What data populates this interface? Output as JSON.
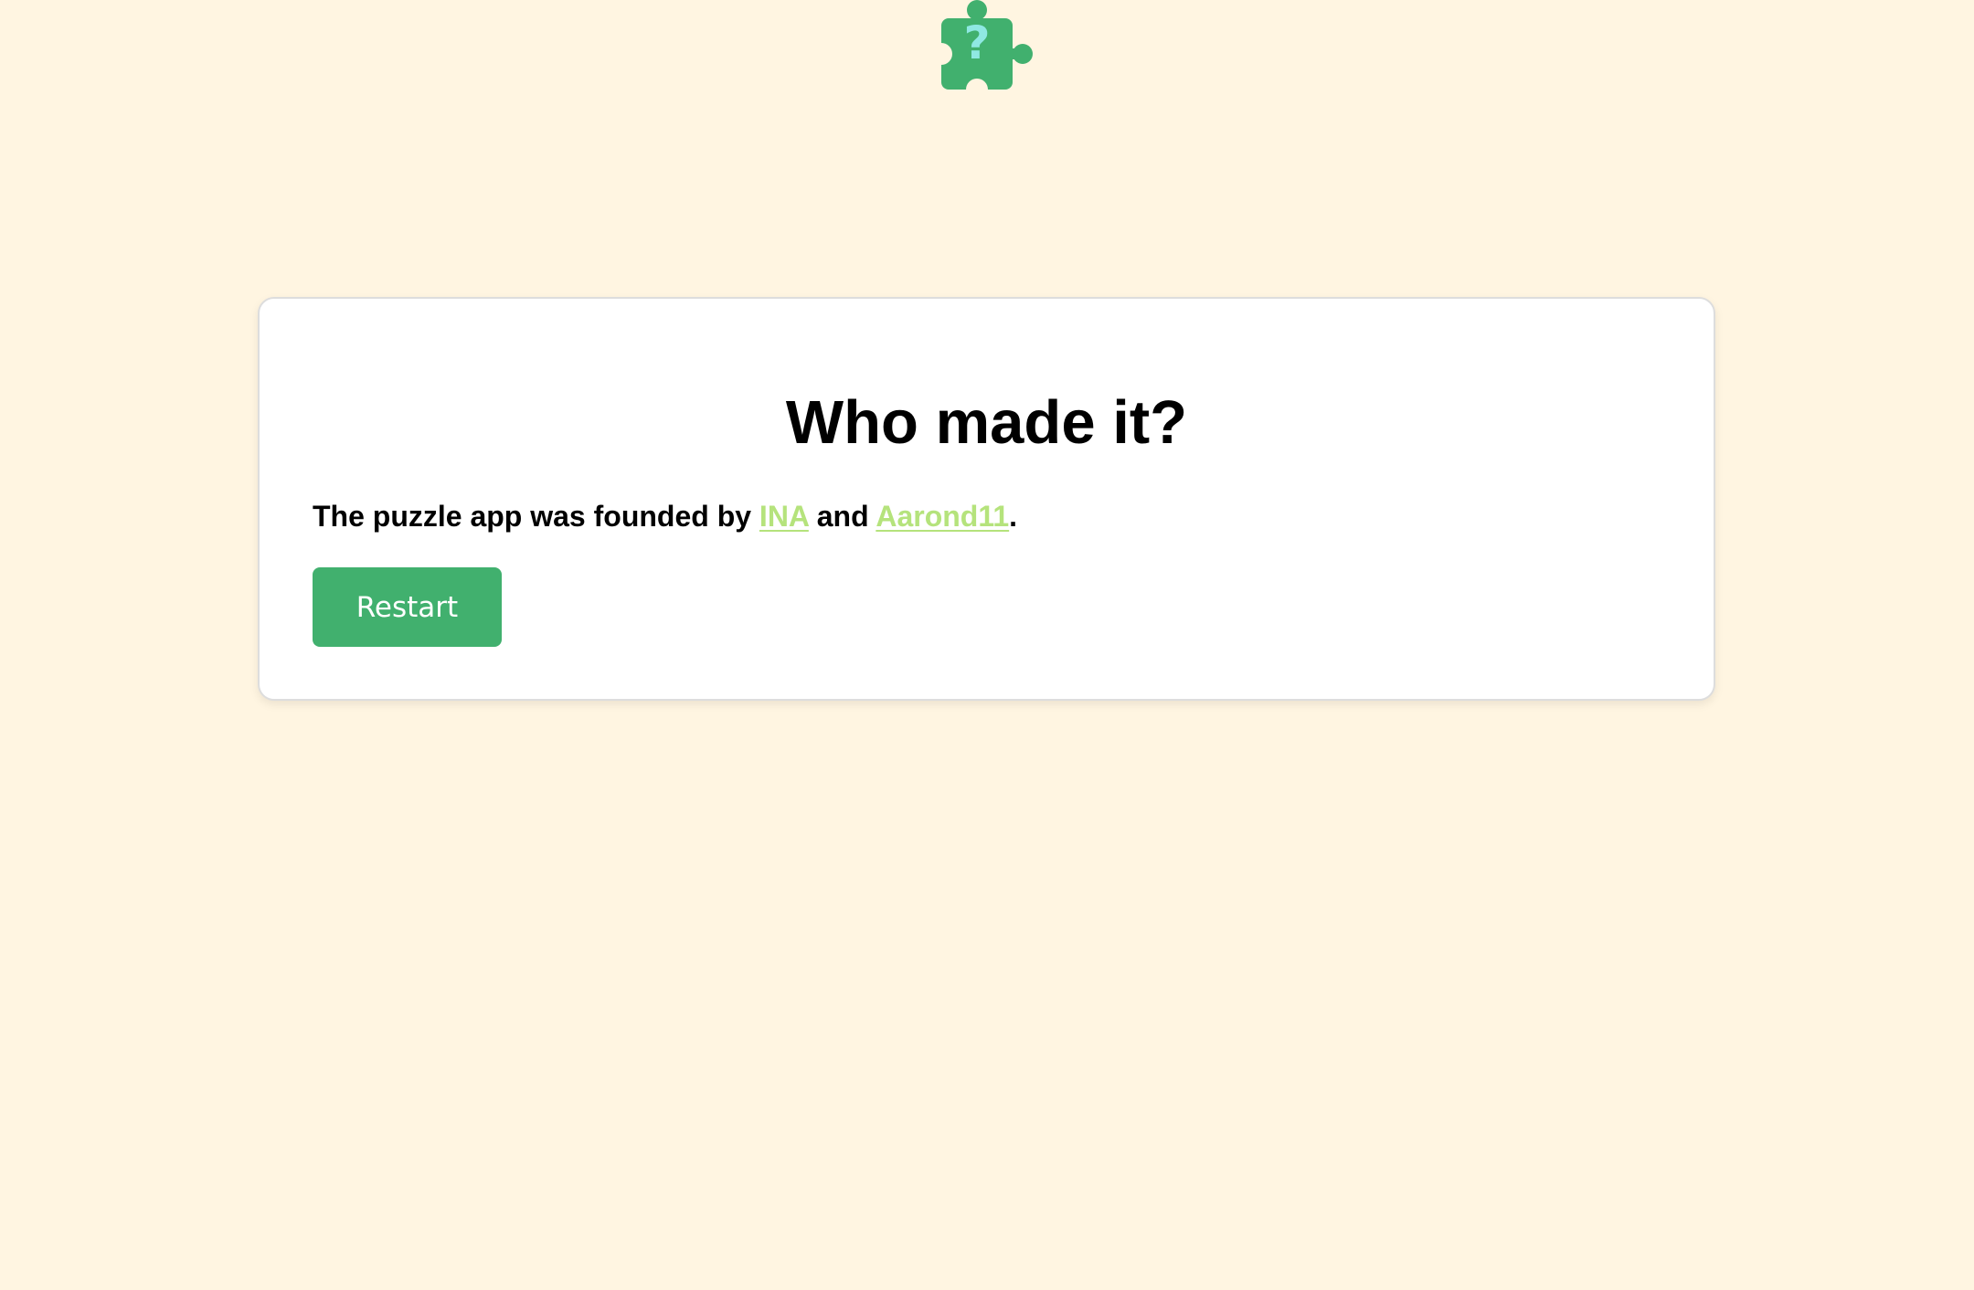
{
  "logo": {
    "icon": "puzzle-piece-question-icon",
    "color": "#41b06e",
    "mark_color": "#8fe8e2"
  },
  "card": {
    "title": "Who made it?",
    "desc_prefix": "The puzzle app was founded by ",
    "link1": "INA",
    "desc_mid": " and ",
    "link2": "Aarond11",
    "desc_suffix": ".",
    "restart_label": "Restart"
  },
  "colors": {
    "background": "#fff5e1",
    "accent": "#41b06e",
    "link": "#b5e37c"
  }
}
